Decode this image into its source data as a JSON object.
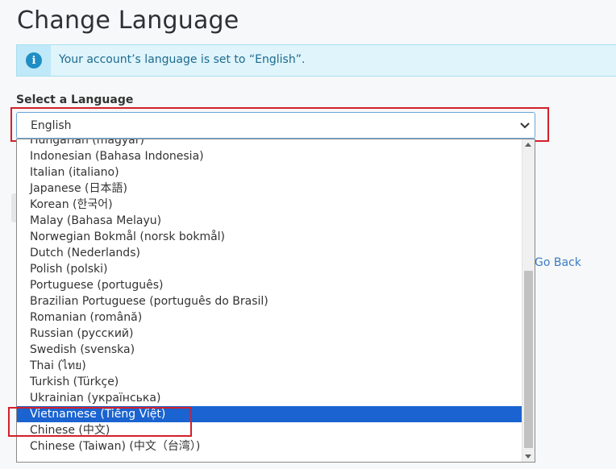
{
  "page": {
    "title": "Change Language"
  },
  "alert": {
    "icon": "info-icon",
    "text": "Your account’s language is set to “English”."
  },
  "form": {
    "label": "Select a Language",
    "selected_value": "English"
  },
  "dropdown": {
    "options": [
      "Hungarian (magyar)",
      "Indonesian (Bahasa Indonesia)",
      "Italian (italiano)",
      "Japanese (日本語)",
      "Korean (한국어)",
      "Malay (Bahasa Melayu)",
      "Norwegian Bokmål (norsk bokmål)",
      "Dutch (Nederlands)",
      "Polish (polski)",
      "Portuguese (português)",
      "Brazilian Portuguese (português do Brasil)",
      "Romanian (română)",
      "Russian (русский)",
      "Swedish (svenska)",
      "Thai (ไทย)",
      "Turkish (Türkçe)",
      "Ukrainian (українська)",
      "Vietnamese (Tiếng Việt)",
      "Chinese (中文)",
      "Chinese (Taiwan) (中文（台湾）)"
    ],
    "highlighted": "Vietnamese (Tiếng Việt)"
  },
  "links": {
    "go_back": "Go Back"
  },
  "colors": {
    "accent": "#1a63d0",
    "alert_bg": "#dff4fb",
    "annotation": "#d3202a"
  }
}
